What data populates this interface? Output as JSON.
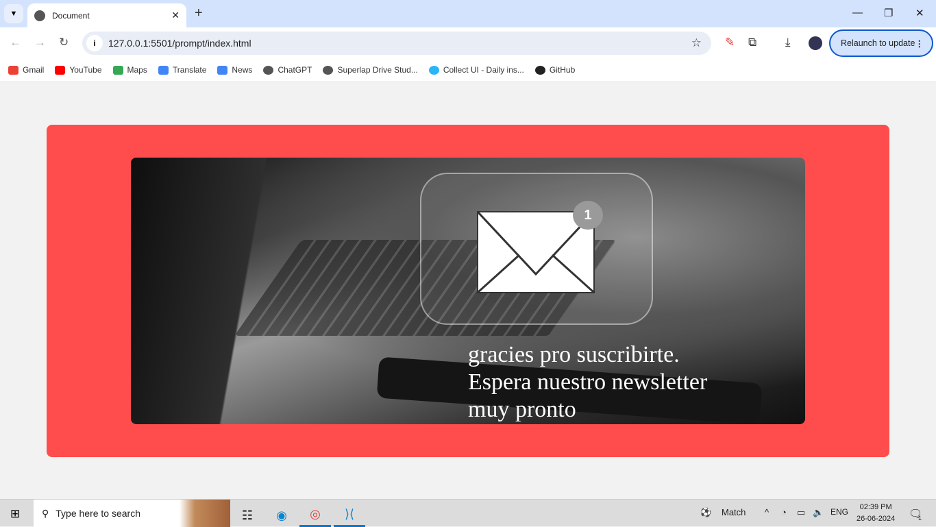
{
  "browser": {
    "tab_title": "Document",
    "url": "127.0.0.1:5501/prompt/index.html",
    "relaunch_label": "Relaunch to update",
    "bookmarks": [
      {
        "label": "Gmail",
        "color": "#ea4335"
      },
      {
        "label": "YouTube",
        "color": "#ff0000"
      },
      {
        "label": "Maps",
        "color": "#34a853"
      },
      {
        "label": "Translate",
        "color": "#4285f4"
      },
      {
        "label": "News",
        "color": "#4285f4"
      },
      {
        "label": "ChatGPT",
        "color": "#555555"
      },
      {
        "label": "Superlap Drive Stud...",
        "color": "#555555"
      },
      {
        "label": "Collect UI - Daily ins...",
        "color": "#29b6f6"
      },
      {
        "label": "GitHub",
        "color": "#222222"
      }
    ]
  },
  "page": {
    "card_color": "#ff4d4d",
    "badge_count": "1",
    "message_lines": [
      "gracies pro suscribirte.",
      "Espera nuestro newsletter",
      "muy pronto"
    ]
  },
  "taskbar": {
    "search_placeholder": "Type here to search",
    "weather_label": "Match",
    "language": "ENG",
    "time": "02:39 PM",
    "date": "26-06-2024",
    "notification_count": "1"
  }
}
